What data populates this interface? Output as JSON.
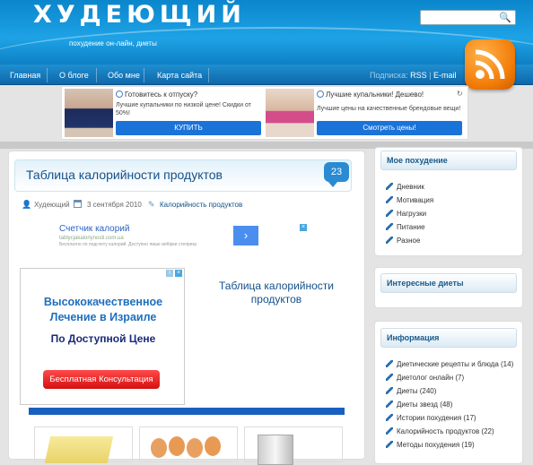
{
  "site": {
    "title": "ХУДЕЮЩИЙ",
    "tagline": "похудение он-лайн, диеты"
  },
  "nav": {
    "items": [
      "Главная",
      "О блоге",
      "Обо мне",
      "Карта сайта"
    ],
    "subscribe_label": "Подписка:",
    "rss": "RSS",
    "email": "E-mail"
  },
  "top_ads": [
    {
      "title": "Готовитесь к отпуску?",
      "text": "Лучшие купальники по низкой цене! Скидки от 50%!",
      "button": "КУПИТЬ"
    },
    {
      "title": "Лучшие купальники! Дешево!",
      "text": "Лучшие цены на качественные брендовые вещи!",
      "button": "Смотреть цены!"
    }
  ],
  "post": {
    "title": "Таблица калорийности продуктов",
    "comments": "23",
    "author": "Худеющий",
    "date": "3 сентября 2010",
    "category": "Калорийность продуктов",
    "content_title": "Таблица калорийности продуктов"
  },
  "calc_ad": {
    "title": "Счетчик калорий",
    "url": "tablycjakaloriynosti.com.ua",
    "desc": "Бесплатно по подсчету калорий. Доступно лише вибірки степрику"
  },
  "israel_ad": {
    "line1": "Высококачественное",
    "line2": "Лечение в Израиле",
    "line3": "По Доступной Цене",
    "button": "Бесплатная Консультация"
  },
  "sidebar": {
    "my_weight_loss": {
      "title": "Мое похудение",
      "items": [
        "Дневник",
        "Мотивация",
        "Нагрузки",
        "Питание",
        "Разное"
      ]
    },
    "interesting_diets": {
      "title": "Интересные диеты"
    },
    "info": {
      "title": "Информация",
      "items": [
        "Диетические рецепты и блюда (14)",
        "Диетолог онлайн (7)",
        "Диеты (240)",
        "Диеты звезд (48)",
        "Истории похудения (17)",
        "Калорийность продуктов (22)",
        "Методы похудения (19)"
      ]
    }
  },
  "colors": {
    "header": "#1ea3e6",
    "nav": "#0e67aa",
    "link": "#14508a",
    "accent_orange": "#f27c07",
    "ad_button": "#1a73d8",
    "cta_red": "#e01a1a"
  }
}
